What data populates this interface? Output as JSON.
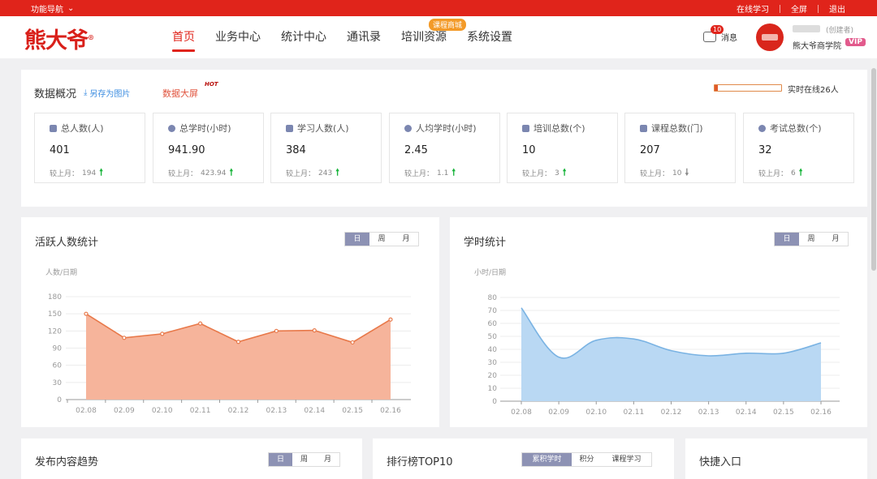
{
  "topbar": {
    "nav_label": "功能导航",
    "links": [
      "在线学习",
      "全屏",
      "退出"
    ]
  },
  "header": {
    "logo": "熊大爷",
    "nav": [
      "首页",
      "业务中心",
      "统计中心",
      "通讯录",
      "培训资源",
      "系统设置"
    ],
    "active_nav": "首页",
    "course_badge": "课程商城",
    "msg_label": "消息",
    "msg_count": "10",
    "role": "(创建者)",
    "college": "熊大爷商学院",
    "vip": "VIP"
  },
  "overview": {
    "title": "数据概况",
    "save_label": "另存为图片",
    "bigscreen_label": "数据大屏",
    "hot_label": "HOT",
    "online_text": "实时在线26人",
    "stats": [
      {
        "label": "总人数(人)",
        "value": "401",
        "cmp_label": "较上月：",
        "cmp_value": "194",
        "trend": "up",
        "icon": "bar-chart-icon"
      },
      {
        "label": "总学时(小时)",
        "value": "941.90",
        "cmp_label": "较上月：",
        "cmp_value": "423.94",
        "trend": "up",
        "icon": "clock-icon"
      },
      {
        "label": "学习人数(人)",
        "value": "384",
        "cmp_label": "较上月：",
        "cmp_value": "243",
        "trend": "up",
        "icon": "users-icon"
      },
      {
        "label": "人均学时(小时)",
        "value": "2.45",
        "cmp_label": "较上月：",
        "cmp_value": "1.1",
        "trend": "up",
        "icon": "user-icon"
      },
      {
        "label": "培训总数(个)",
        "value": "10",
        "cmp_label": "较上月：",
        "cmp_value": "3",
        "trend": "up",
        "icon": "training-icon"
      },
      {
        "label": "课程总数(门)",
        "value": "207",
        "cmp_label": "较上月：",
        "cmp_value": "10",
        "trend": "down",
        "icon": "list-icon"
      },
      {
        "label": "考试总数(个)",
        "value": "32",
        "cmp_label": "较上月：",
        "cmp_value": "6",
        "trend": "up",
        "icon": "pin-icon"
      }
    ]
  },
  "active_chart": {
    "title": "活跃人数统计",
    "tabs": [
      "日",
      "周",
      "月"
    ],
    "active_tab": "日",
    "unit": "人数/日期"
  },
  "hours_chart": {
    "title": "学时统计",
    "tabs": [
      "日",
      "周",
      "月"
    ],
    "active_tab": "日",
    "unit": "小时/日期"
  },
  "bottom": {
    "trend_title": "发布内容趋势",
    "trend_tabs": [
      "日",
      "周",
      "月"
    ],
    "rank_title": "排行榜TOP10",
    "rank_tabs": [
      "累积学时",
      "积分",
      "课程学习"
    ],
    "quick_title": "快捷入口"
  },
  "colors": {
    "brand_red": "#e0241b",
    "area_orange_line": "#e8794a",
    "area_orange_fill": "#f6b49b",
    "area_blue_line": "#7ab3e3",
    "area_blue_fill": "#b9d8f3",
    "up_green": "#17b43a"
  },
  "chart_data": [
    {
      "type": "area",
      "title": "活跃人数统计",
      "ylabel": "人数/日期",
      "x": [
        "02.08",
        "02.09",
        "02.10",
        "02.11",
        "02.12",
        "02.13",
        "02.14",
        "02.15",
        "02.16"
      ],
      "values": [
        150,
        108,
        115,
        133,
        101,
        120,
        121,
        100,
        140
      ],
      "ylim": [
        0,
        180
      ],
      "yticks": [
        0,
        30,
        60,
        90,
        120,
        150,
        180
      ],
      "smooth": false,
      "grid": true
    },
    {
      "type": "area",
      "title": "学时统计",
      "ylabel": "小时/日期",
      "x": [
        "02.08",
        "02.09",
        "02.10",
        "02.11",
        "02.12",
        "02.13",
        "02.14",
        "02.15",
        "02.16"
      ],
      "values": [
        72,
        34,
        47,
        48,
        39,
        35,
        37,
        37,
        45
      ],
      "ylim": [
        0,
        80
      ],
      "yticks": [
        0,
        10,
        20,
        30,
        40,
        50,
        60,
        70,
        80
      ],
      "smooth": true,
      "grid": true
    }
  ]
}
